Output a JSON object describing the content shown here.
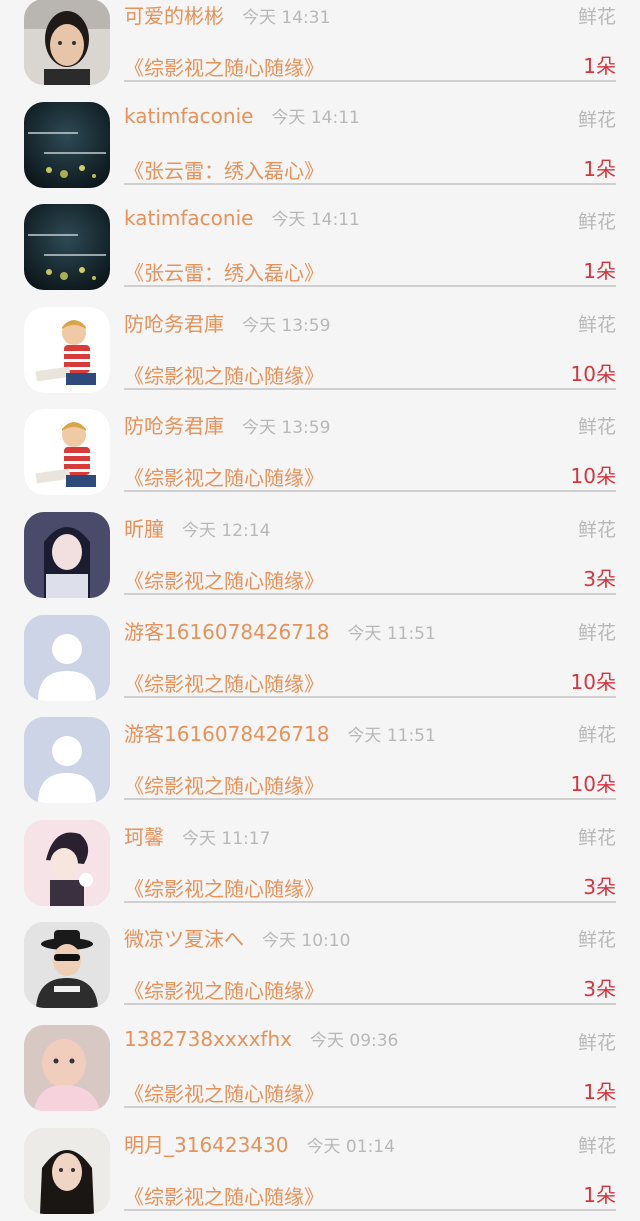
{
  "rows": [
    {
      "name": "可爱的彬彬",
      "time": "今天 14:31",
      "gift": "鲜花",
      "book": "《综影视之随心随缘》",
      "count": "1朵",
      "avatar": "girl-photo"
    },
    {
      "name": "katimfaconie",
      "time": "今天 14:11",
      "gift": "鲜花",
      "book": "《张云雷：绣入磊心》",
      "count": "1朵",
      "avatar": "dark-text-art"
    },
    {
      "name": "katimfaconie",
      "time": "今天 14:11",
      "gift": "鲜花",
      "book": "《张云雷：绣入磊心》",
      "count": "1朵",
      "avatar": "dark-text-art"
    },
    {
      "name": "防呛务君庫",
      "time": "今天 13:59",
      "gift": "鲜花",
      "book": "《综影视之随心随缘》",
      "count": "10朵",
      "avatar": "boy-reading"
    },
    {
      "name": "防呛务君庫",
      "time": "今天 13:59",
      "gift": "鲜花",
      "book": "《综影视之随心随缘》",
      "count": "10朵",
      "avatar": "boy-reading"
    },
    {
      "name": "昕朣",
      "time": "今天 12:14",
      "gift": "鲜花",
      "book": "《综影视之随心随缘》",
      "count": "3朵",
      "avatar": "anime-girl"
    },
    {
      "name": "游客1616078426718",
      "time": "今天 11:51",
      "gift": "鲜花",
      "book": "《综影视之随心随缘》",
      "count": "10朵",
      "avatar": "default-avatar"
    },
    {
      "name": "游客1616078426718",
      "time": "今天 11:51",
      "gift": "鲜花",
      "book": "《综影视之随心随缘》",
      "count": "10朵",
      "avatar": "default-avatar"
    },
    {
      "name": "珂馨",
      "time": "今天 11:17",
      "gift": "鲜花",
      "book": "《综影视之随心随缘》",
      "count": "3朵",
      "avatar": "anime-boy-pink"
    },
    {
      "name": "微凉ツ夏沫へ",
      "time": "今天 10:10",
      "gift": "鲜花",
      "book": "《综影视之随心随缘》",
      "count": "3朵",
      "avatar": "hat-sunglasses"
    },
    {
      "name": "1382738xxxxfhx",
      "time": "今天 09:36",
      "gift": "鲜花",
      "book": "《综影视之随心随缘》",
      "count": "1朵",
      "avatar": "baby-photo"
    },
    {
      "name": "明月_316423430",
      "time": "今天 01:14",
      "gift": "鲜花",
      "book": "《综影视之随心随缘》",
      "count": "1朵",
      "avatar": "woman-photo"
    }
  ],
  "colors": {
    "name": "#e6925a",
    "time": "#b8b8b8",
    "count": "#d8343e",
    "background": "#f5f5f5"
  }
}
